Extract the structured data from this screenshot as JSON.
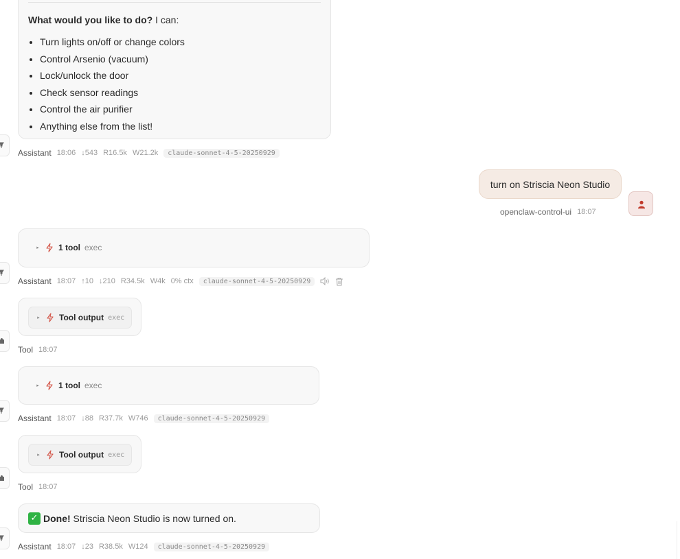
{
  "capabilities_message": {
    "intro_bold": "What would you like to do?",
    "intro_rest": " I can:",
    "items": [
      "Turn lights on/off or change colors",
      "Control Arsenio (vacuum)",
      "Lock/unlock the door",
      "Check sensor readings",
      "Control the air purifier",
      "Anything else from the list!"
    ],
    "meta": {
      "role": "Assistant",
      "time": "18:06",
      "stats": [
        "↓543",
        "R16.5k",
        "W21.2k"
      ],
      "model": "claude-sonnet-4-5-20250929"
    }
  },
  "user_message": {
    "text": "turn on Striscia Neon Studio",
    "sender": "openclaw-control-ui",
    "time": "18:07"
  },
  "tool_call_1": {
    "summary_bold": "1 tool",
    "summary_sub": "exec",
    "meta": {
      "role": "Assistant",
      "time": "18:07",
      "stats": [
        "↑10",
        "↓210",
        "R34.5k",
        "W4k",
        "0% ctx"
      ],
      "model": "claude-sonnet-4-5-20250929"
    }
  },
  "tool_output_1": {
    "label": "Tool output",
    "sub": "exec",
    "meta": {
      "role": "Tool",
      "time": "18:07"
    }
  },
  "tool_call_2": {
    "summary_bold": "1 tool",
    "summary_sub": "exec",
    "meta": {
      "role": "Assistant",
      "time": "18:07",
      "stats": [
        "↓88",
        "R37.7k",
        "W746"
      ],
      "model": "claude-sonnet-4-5-20250929"
    }
  },
  "tool_output_2": {
    "label": "Tool output",
    "sub": "exec",
    "meta": {
      "role": "Tool",
      "time": "18:07"
    }
  },
  "final_message": {
    "emoji": "✅",
    "bold": "Done!",
    "rest": " Striscia Neon Studio is now turned on.",
    "meta": {
      "role": "Assistant",
      "time": "18:07",
      "stats": [
        "↓23",
        "R38.5k",
        "W124"
      ],
      "model": "claude-sonnet-4-5-20250929"
    }
  },
  "colors": {
    "accent": "#c0392b",
    "user_bubble": "#f5ebe4",
    "bubble": "#f8f8f8"
  },
  "icons": {
    "tool": "lightning-icon",
    "assistant_avatar": "pin-icon",
    "tool_avatar": "puzzle-icon",
    "user_avatar": "person-icon"
  }
}
